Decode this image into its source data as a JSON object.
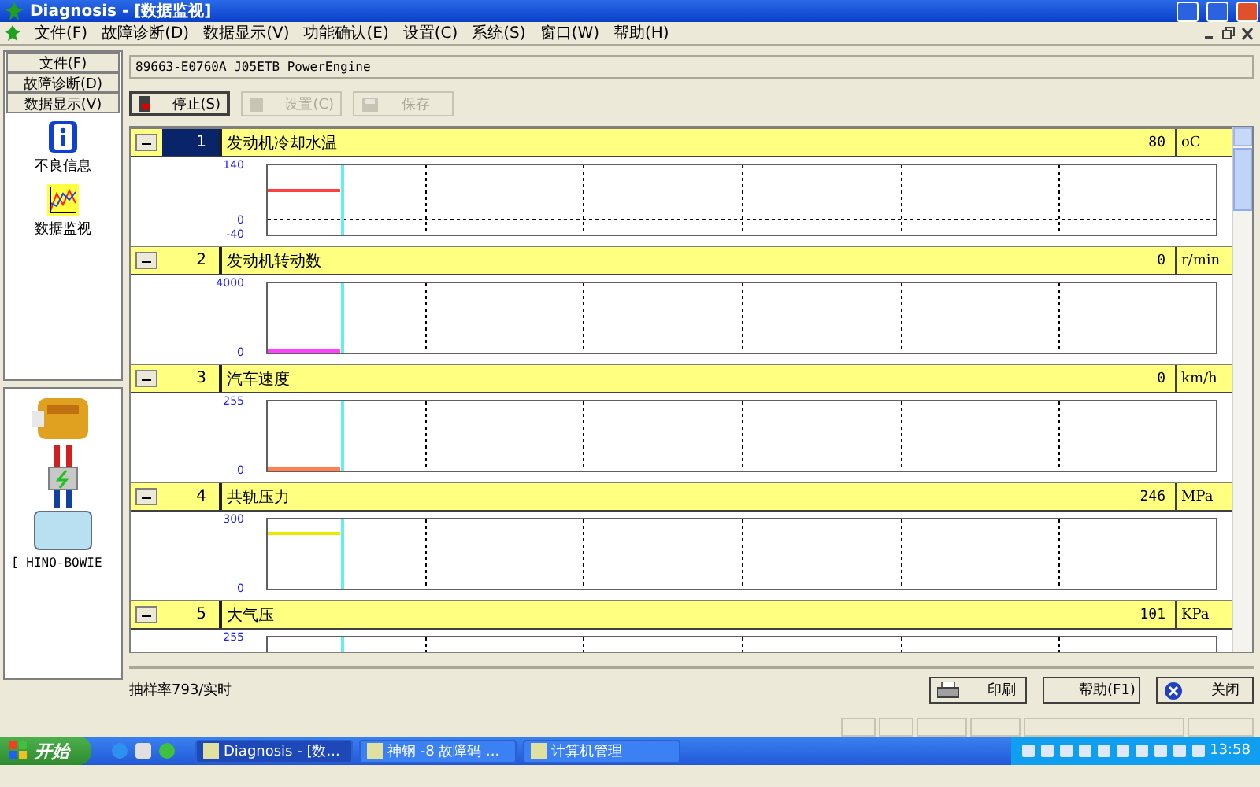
{
  "window": {
    "title": "Diagnosis - [数据监视]"
  },
  "menu": [
    "文件(F)",
    "故障诊断(D)",
    "数据显示(V)",
    "功能确认(E)",
    "设置(C)",
    "系统(S)",
    "窗口(W)",
    "帮助(H)"
  ],
  "sidebar": {
    "buttons": [
      "文件(F)",
      "故障诊断(D)",
      "数据显示(V)"
    ],
    "items": [
      {
        "label": "不良信息",
        "kind": "info"
      },
      {
        "label": "数据监视",
        "kind": "chart"
      }
    ],
    "connection": "[ HINO-BOWIE"
  },
  "ecu_info": "89663-E0760A J05ETB PowerEngine",
  "toolbar": [
    {
      "label": "停止(S)",
      "disabled": false,
      "kind": "stop"
    },
    {
      "label": "设置(C)",
      "disabled": true,
      "kind": "settings"
    },
    {
      "label": "保存",
      "disabled": true,
      "kind": "save"
    }
  ],
  "channels": [
    {
      "number": "1",
      "name": "发动机冷却水温",
      "value": "80",
      "unit": "oC",
      "selected": true,
      "color": "#ff4040",
      "y_labels": [
        "140",
        "0",
        "-40"
      ]
    },
    {
      "number": "2",
      "name": "发动机转动数",
      "value": "0",
      "unit": "r/min",
      "selected": false,
      "color": "#ff40ff",
      "y_labels": [
        "4000",
        "0"
      ]
    },
    {
      "number": "3",
      "name": "汽车速度",
      "value": "0",
      "unit": "km/h",
      "selected": false,
      "color": "#ff8050",
      "y_labels": [
        "255",
        "0"
      ]
    },
    {
      "number": "4",
      "name": "共轨压力",
      "value": "246",
      "unit": "MPa",
      "selected": false,
      "color": "#e8e800",
      "y_labels": [
        "300",
        "0"
      ]
    },
    {
      "number": "5",
      "name": "大气压",
      "value": "101",
      "unit": "KPa",
      "selected": false,
      "y_labels": [
        "255"
      ]
    }
  ],
  "status": "抽样率793/实时",
  "buttons": [
    {
      "label": "印刷",
      "kind": "print"
    },
    {
      "label": "帮助(F1)",
      "kind": "help"
    },
    {
      "label": "关闭",
      "kind": "close"
    }
  ],
  "taskbar": {
    "start": "开始",
    "tasks": [
      {
        "label": "Diagnosis - [数...",
        "selected": true
      },
      {
        "label": "神钢 -8  故障码 ...",
        "selected": false
      },
      {
        "label": "计算机管理",
        "selected": false
      }
    ],
    "clock": "13:58"
  }
}
